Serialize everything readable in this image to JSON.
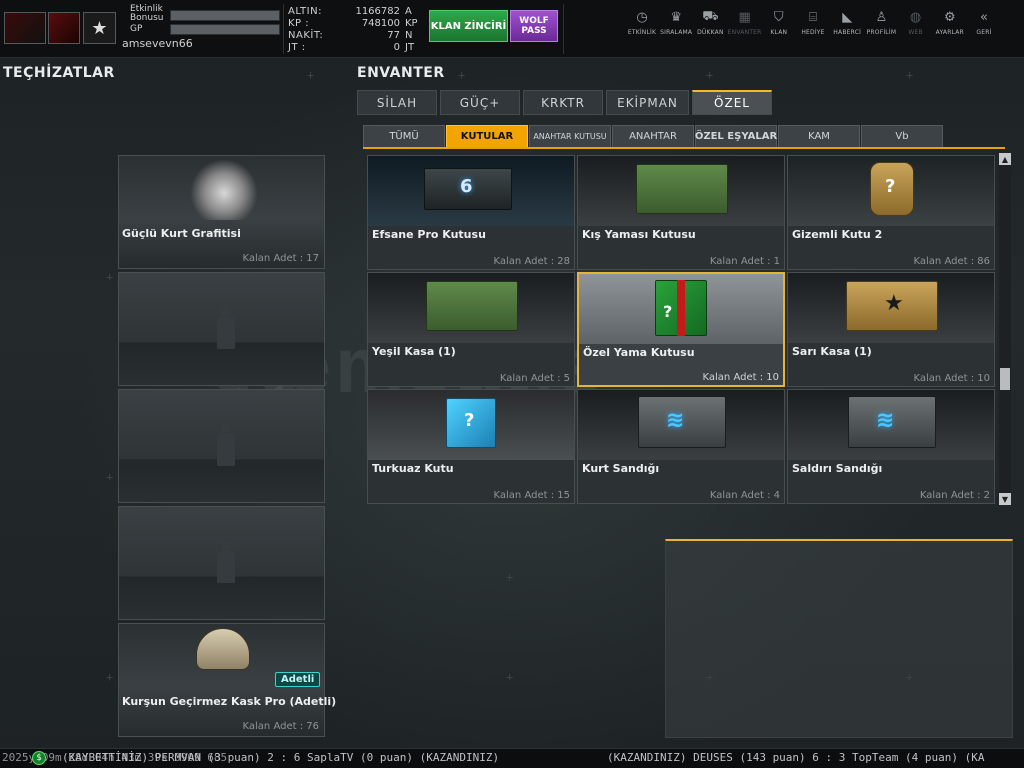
{
  "topbar": {
    "bonus_label": "Etkinlik\nBonusu",
    "gp_label": "GP",
    "username": "amsevevn66",
    "currencies": [
      {
        "label": "ALTIN:",
        "value": "1166782",
        "unit": "A"
      },
      {
        "label": "KP  :",
        "value": "748100",
        "unit": "KP"
      },
      {
        "label": "NAKİT:",
        "value": "77",
        "unit": "N"
      },
      {
        "label": "JT  :",
        "value": "0",
        "unit": "JT"
      }
    ],
    "klan_button": "KLAN ZİNCİRİ",
    "wolf_button": "WOLF PASS",
    "nav": [
      {
        "icon": "clock-icon",
        "glyph": "◷",
        "label": "ETKİNLİK"
      },
      {
        "icon": "rank-icon",
        "glyph": "♛",
        "label": "SIRALAMA"
      },
      {
        "icon": "cart-icon",
        "glyph": "⛟",
        "label": "DÜKKAN"
      },
      {
        "icon": "inventory-icon",
        "glyph": "▦",
        "label": "ENVANTER"
      },
      {
        "icon": "clan-icon",
        "glyph": "⛉",
        "label": "KLAN"
      },
      {
        "icon": "gift-icon",
        "glyph": "⌸",
        "label": "HEDİYE"
      },
      {
        "icon": "megaphone-icon",
        "glyph": "◣",
        "label": "HABERCİ"
      },
      {
        "icon": "profile-icon",
        "glyph": "♙",
        "label": "PROFİLİM"
      },
      {
        "icon": "web-icon",
        "glyph": "◍",
        "label": "WEB"
      },
      {
        "icon": "gear-icon",
        "glyph": "⚙",
        "label": "AYARLAR"
      },
      {
        "icon": "back-icon",
        "glyph": "«",
        "label": "GERİ"
      }
    ]
  },
  "left": {
    "title": "TEÇHİZATLAR",
    "slots": [
      {
        "name": "Güçlü Kurt Grafitisi",
        "count": "Kalan Adet : 17"
      },
      {
        "name": "",
        "count": ""
      },
      {
        "name": "",
        "count": ""
      },
      {
        "name": "",
        "count": ""
      },
      {
        "name": "Kurşun Geçirmez Kask Pro (Adetli)",
        "count": "Kalan Adet : 76",
        "badge": "Adetli"
      }
    ]
  },
  "inventory": {
    "title": "ENVANTER",
    "tabs": [
      "SİLAH",
      "GÜÇ+",
      "KRKTR",
      "EKİPMAN",
      "ÖZEL"
    ],
    "active_tab": "ÖZEL",
    "subtabs": [
      "TÜMÜ",
      "KUTULAR",
      "ANAHTAR KUTUSU",
      "ANAHTAR",
      "ÖZEL EŞYALAR",
      "KAM",
      "Vb"
    ],
    "active_subtab": "KUTULAR",
    "items": [
      {
        "name": "Efsane Pro Kutusu",
        "count": "Kalan Adet : 28"
      },
      {
        "name": "Kış Yaması Kutusu",
        "count": "Kalan Adet : 1"
      },
      {
        "name": "Gizemli Kutu 2",
        "count": "Kalan Adet : 86"
      },
      {
        "name": "Yeşil Kasa (1)",
        "count": "Kalan Adet : 5"
      },
      {
        "name": "Özel Yama Kutusu",
        "count": "Kalan Adet : 10"
      },
      {
        "name": "Sarı Kasa (1)",
        "count": "Kalan Adet : 10"
      },
      {
        "name": "Turkuaz Kutu",
        "count": "Kalan Adet : 15"
      },
      {
        "name": "Kurt Sandığı",
        "count": "Kalan Adet : 4"
      },
      {
        "name": "Saldırı Sandığı",
        "count": "Kalan Adet : 2"
      }
    ],
    "selected_index": 4
  },
  "ticker": {
    "left": "2025y 09m 28d 04h 43m 39s 0909 685",
    "msg1": "(KAYBETTİNİZ) PERMVAN (3 puan) 2 : 6 SaplaTV (0 puan) (KAZANDINIZ)",
    "msg2": "(KAZANDINIZ) DEUSES (143 puan) 6 : 3 TopTeam (4 puan) (KA"
  },
  "watermark": "itemsatis"
}
